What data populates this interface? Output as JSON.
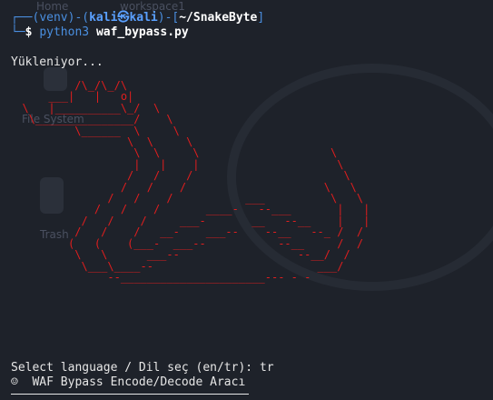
{
  "terminal": {
    "prompt_prefix": "┌──(",
    "venv": "venv",
    "prompt_sep1": ")-(",
    "user": "kali",
    "at_symbol": "㉿",
    "host": "kali",
    "prompt_sep2": ")-[",
    "path": "~/SnakeByte",
    "prompt_close": "]",
    "prompt_second": "└─",
    "dollar": "$",
    "command": "python3",
    "command_arg": "waf_bypass.py",
    "loading": "Yükleniyor...",
    "ascii_art": "          /\\_/\\_/\\\n      ___|   |   o|\n  \\   |__________\\_/  \\\n   \\_______________/    \\\n          \\______  \\     \\\n                  \\  \\     \\\n                   \\  \\     \\                    \\\n                   |   |    |                     \\\n                  /   /    /                       \\\n                 /   /    /                     \\   \\\n               /   /    /           ___          \\   \\\n             /   /    /       ____-   --___       |   |\n           /   /    /     ___-       __   --__    |   |\n          /   /    /   __-    ___--    --__   --_ /  /\n         (   (    (___-  ___--           --__     /  /\n          \\   \\      ___--                  --__/  /\n           \\___\\____--                         ___/\n               --______________________--- - -",
    "language_prompt": "Select language / Dil seç (en/tr): ",
    "language_input": "tr",
    "tool_icon": "☺",
    "tool_title": "WAF Bypass Encode/Decode Aracı"
  },
  "desktop": {
    "home_label": "Home",
    "workspace_label": "workspace1",
    "filesystem_label": "File System",
    "trash_label": "Trash"
  }
}
